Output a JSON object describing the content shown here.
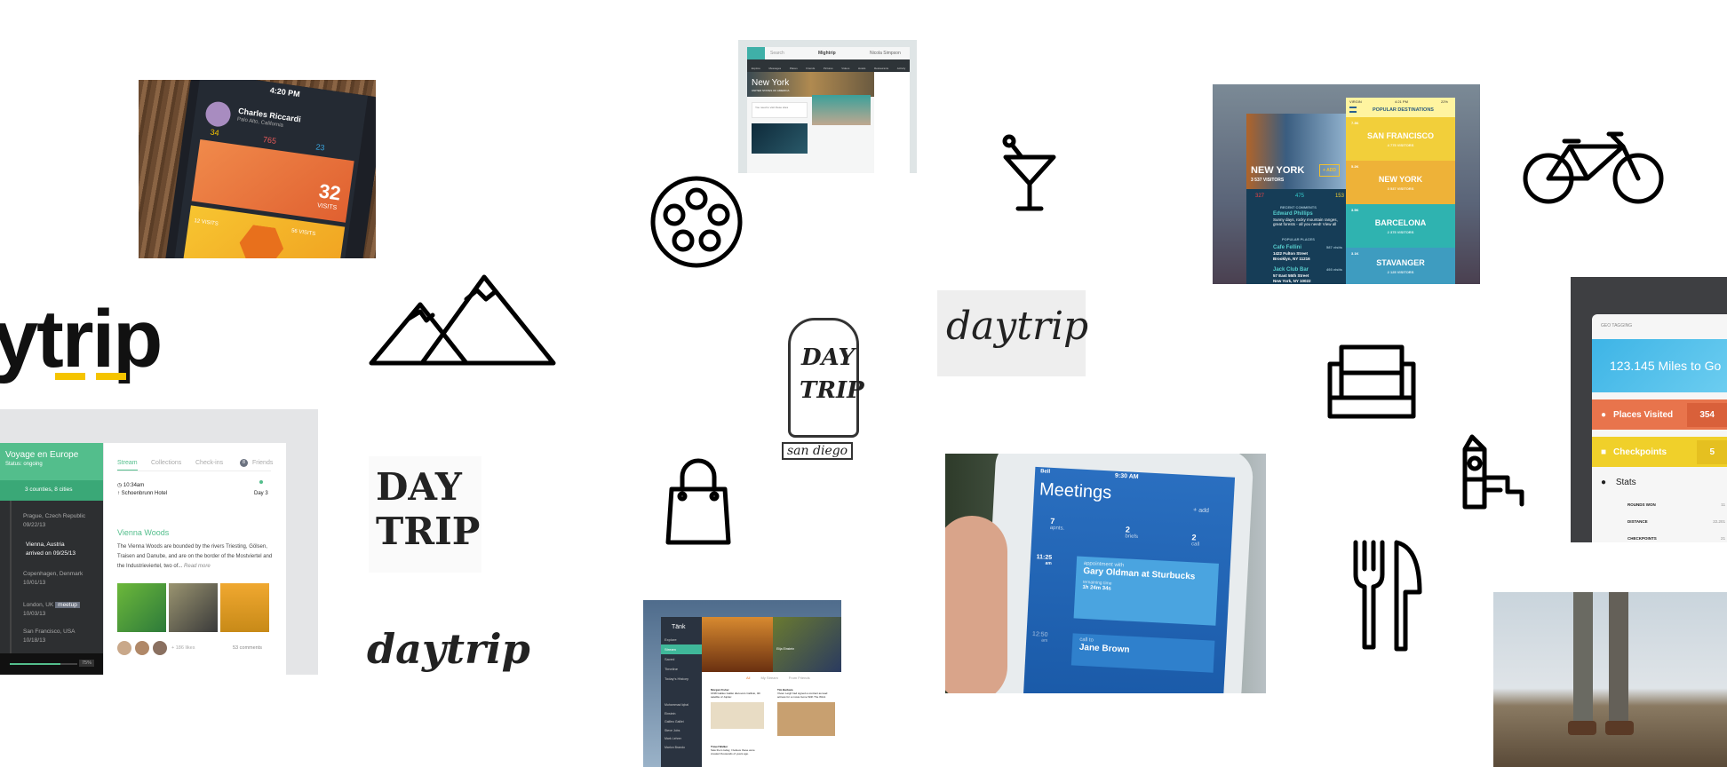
{
  "phone_app": {
    "time": "4:20 PM",
    "user": "Charles Riccardi",
    "location": "Palo Alto, California",
    "stats": [
      "34",
      "765",
      "23"
    ],
    "visits": "32",
    "visits_label": "VISITS",
    "hex_left": "12 VISITS",
    "hex_right": "56 VISITS"
  },
  "web_app": {
    "search": "Search",
    "logo": "Mightrip",
    "user": "Nicola Simpson",
    "nav": [
      "Explore",
      "Messages",
      "Places",
      "Friends",
      "Pictures",
      "Videos",
      "Hotels",
      "Restaurants",
      "Activity"
    ],
    "hero_title": "New York",
    "hero_sub": "UNITED STATES OF AMERICA",
    "composer_placeholder": "You need to visit these sites"
  },
  "logo": {
    "text": "ytrip",
    "accent": "#f5c400"
  },
  "sketches": {
    "daytrip_1": "daytrip",
    "daytrip_2": "DAY TRIP",
    "daytrip_3": "daytrip",
    "backpack_top": "DAY",
    "backpack_bottom": "TRIP",
    "backpack_tag": "san diego"
  },
  "nyc_app": {
    "city": "NEW YORK",
    "visitors": "3 537 VISITORS",
    "add": "+ ADD",
    "counts": [
      "327",
      "475",
      "153"
    ],
    "recent_comments": "RECENT COMMENTS",
    "commenter": "Edward Phillips",
    "comment": "Sunny days, rocky mountain ranges, great forests - all you need! View all",
    "popular_places": "POPULAR PLACES",
    "places": [
      {
        "name": "Cafe Fellini",
        "address": "1422 Fulton Street",
        "city": "Brooklyn, NY 11216",
        "visits": "587 visits"
      },
      {
        "name": "Jack Club Bar",
        "address": "57 East 55th Street",
        "city": "New York, NY 10022",
        "visits": "493 visits"
      }
    ],
    "carrier": "VIRGIN",
    "time": "4:21 PM",
    "battery": "22%",
    "header": "POPULAR DESTINATIONS",
    "destinations": [
      {
        "name": "SAN FRANCISCO",
        "visitors": "4 775 VISITORS",
        "likes": "7.3K",
        "color": "#f2cf3a"
      },
      {
        "name": "NEW YORK",
        "visitors": "3 537 VISITORS",
        "likes": "5.2K",
        "color": "#eeb238"
      },
      {
        "name": "BARCELONA",
        "visitors": "2 375 VISITORS",
        "likes": "3.5K",
        "color": "#2fb3b0"
      },
      {
        "name": "STAVANGER",
        "visitors": "2 125 VISITORS",
        "likes": "3.1K",
        "color": "#3e9cc0"
      }
    ]
  },
  "geo": {
    "title": "GEO TAGGING",
    "miles": "123.145 Miles to Go",
    "places_label": "Places Visited",
    "places_value": "354",
    "checkpoints_label": "Checkpoints",
    "checkpoints_value": "5",
    "stats_label": "Stats",
    "stats": [
      {
        "label": "ROUNDS WON",
        "value": "11"
      },
      {
        "label": "DISTANCE",
        "value": "22.201"
      },
      {
        "label": "CHECKPOINTS",
        "value": "21"
      }
    ],
    "colors": {
      "places": "#e8744c",
      "checkpoints": "#f0d02a",
      "map": "#3db4e6"
    }
  },
  "voyage": {
    "title": "Voyage en Europe",
    "status": "Status: ongoing",
    "summary": "3 counties, 8 cities",
    "stops": [
      {
        "place": "Prague, Czech Republic",
        "date": "09/22/13"
      },
      {
        "place": "Vienna, Austria",
        "date": "arrived on 09/25/13"
      },
      {
        "place": "Copenhagen, Denmark",
        "date": "10/01/13"
      },
      {
        "place": "London, UK",
        "date": "10/03/13",
        "badge": "meetup"
      },
      {
        "place": "San Francisco, USA",
        "date": "10/18/13"
      }
    ],
    "progress": 75,
    "progress_label": "75%",
    "tabs": [
      "Stream",
      "Collections",
      "Check-ins",
      "Friends"
    ],
    "friends_count": "8",
    "time": "10:34am",
    "hotel": "Schoenbrunn Hotel",
    "day": "Day 3",
    "post_title": "Vienna Woods",
    "post_body": "The Vienna Woods are bounded by the rivers Triesting, Gölsen, Traisen and Danube, and are on the border of the Mostviertel and the Industrieviertel, two of...",
    "read_more": "Read more",
    "likes": "+ 186 likes",
    "comments": "53 comments",
    "accent": "#4dbd8a"
  },
  "meetings": {
    "signal": "Bell",
    "time": "9:30 AM",
    "title": "Meetings",
    "add": "add",
    "stats": [
      {
        "value": "7",
        "label": "apnts."
      },
      {
        "value": "2",
        "label": "briefs"
      },
      {
        "value": "2",
        "label": "call"
      }
    ],
    "events": [
      {
        "time": "11:25",
        "ampm": "am",
        "kind": "appointment with",
        "title": "Gary Oldman at Sturbucks",
        "remaining_label": "remaining time",
        "remaining": "1h 24m 34s"
      },
      {
        "time": "12:50",
        "ampm": "am",
        "kind": "call to",
        "title": "Jane Brown"
      }
    ]
  },
  "tank_app": {
    "logo": "Tänk",
    "nav": [
      "Explore",
      "Stream",
      "Saved",
      "Timeline",
      "Today's History"
    ],
    "people": [
      "Muhammad Iqbal",
      "Einstein",
      "Galileo Galilei",
      "Steve Jobs",
      "Mark Lehrer",
      "Marlon Brando"
    ],
    "tabs": [
      "All",
      "My Stream",
      "From Friends"
    ],
    "feature_name": "Elija Einstein",
    "posts": [
      {
        "author": "Morgan Fisher",
        "text": "1638 Galileo Galilei discovers Callisto, 4th satellite of Jupiter."
      },
      {
        "author": "Tim Barbara",
        "text": "Vivien Leigh had signed a contract as lead actress for a movie Gone With The Wind."
      },
      {
        "author": "Travel Walker",
        "text": "Saw them today, I believe these were created thousands of years ago."
      }
    ]
  }
}
